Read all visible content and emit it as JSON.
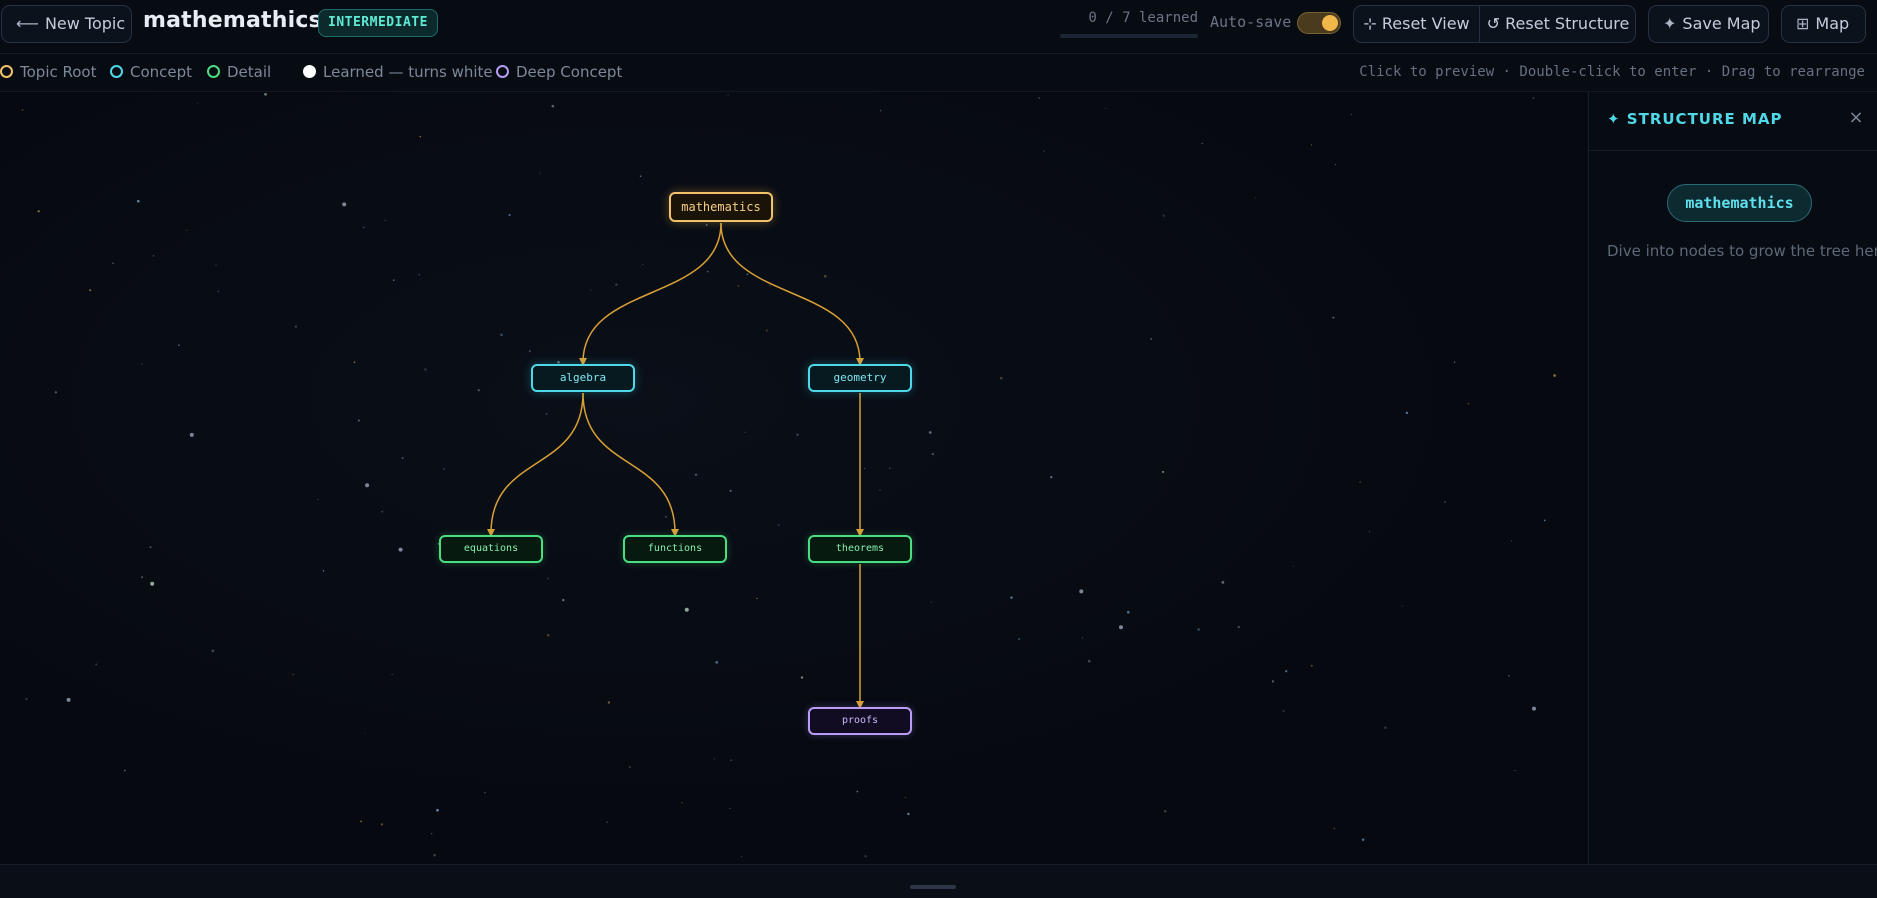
{
  "header": {
    "new_topic_label": "New Topic",
    "new_topic_icon": "arrow-left-icon",
    "title": "mathemathics",
    "level_badge": "INTERMEDIATE",
    "progress_text": "0 / 7 learned",
    "progress_fraction": 0,
    "autosave_label": "Auto-save",
    "autosave_on": true,
    "reset_view_label": "Reset View",
    "reset_view_icon": "⊹",
    "reset_structure_label": "Reset Structure",
    "reset_structure_icon": "↺",
    "save_map_label": "Save Map",
    "save_map_icon": "✦",
    "map_label": "Map",
    "map_icon": "⊞"
  },
  "legend": {
    "items": [
      {
        "label": "Topic Root",
        "color": "#f2c16b"
      },
      {
        "label": "Concept",
        "color": "#4fd8e8"
      },
      {
        "label": "Detail",
        "color": "#4ade80"
      },
      {
        "label": "Learned — turns white",
        "color": "#ffffff"
      },
      {
        "label": "Deep Concept",
        "color": "#b89cf5"
      }
    ],
    "hint": "Click to preview · Double-click to enter · Drag to rearrange"
  },
  "tree": {
    "edge_color": "#d9a035",
    "nodes": [
      {
        "id": "mathematics",
        "label": "mathematics",
        "kind": "root"
      },
      {
        "id": "algebra",
        "label": "algebra",
        "kind": "concept"
      },
      {
        "id": "geometry",
        "label": "geometry",
        "kind": "concept"
      },
      {
        "id": "equations",
        "label": "equations",
        "kind": "detail"
      },
      {
        "id": "functions",
        "label": "functions",
        "kind": "detail"
      },
      {
        "id": "theorems",
        "label": "theorems",
        "kind": "detail"
      },
      {
        "id": "proofs",
        "label": "proofs",
        "kind": "deep"
      }
    ],
    "edges": [
      [
        "mathematics",
        "algebra"
      ],
      [
        "mathematics",
        "geometry"
      ],
      [
        "algebra",
        "equations"
      ],
      [
        "algebra",
        "functions"
      ],
      [
        "geometry",
        "theorems"
      ],
      [
        "theorems",
        "proofs"
      ]
    ]
  },
  "panel": {
    "title": "✦ STRUCTURE MAP",
    "close_icon": "×",
    "root_label": "mathemathics",
    "note": "Dive into nodes to grow the tree here."
  }
}
